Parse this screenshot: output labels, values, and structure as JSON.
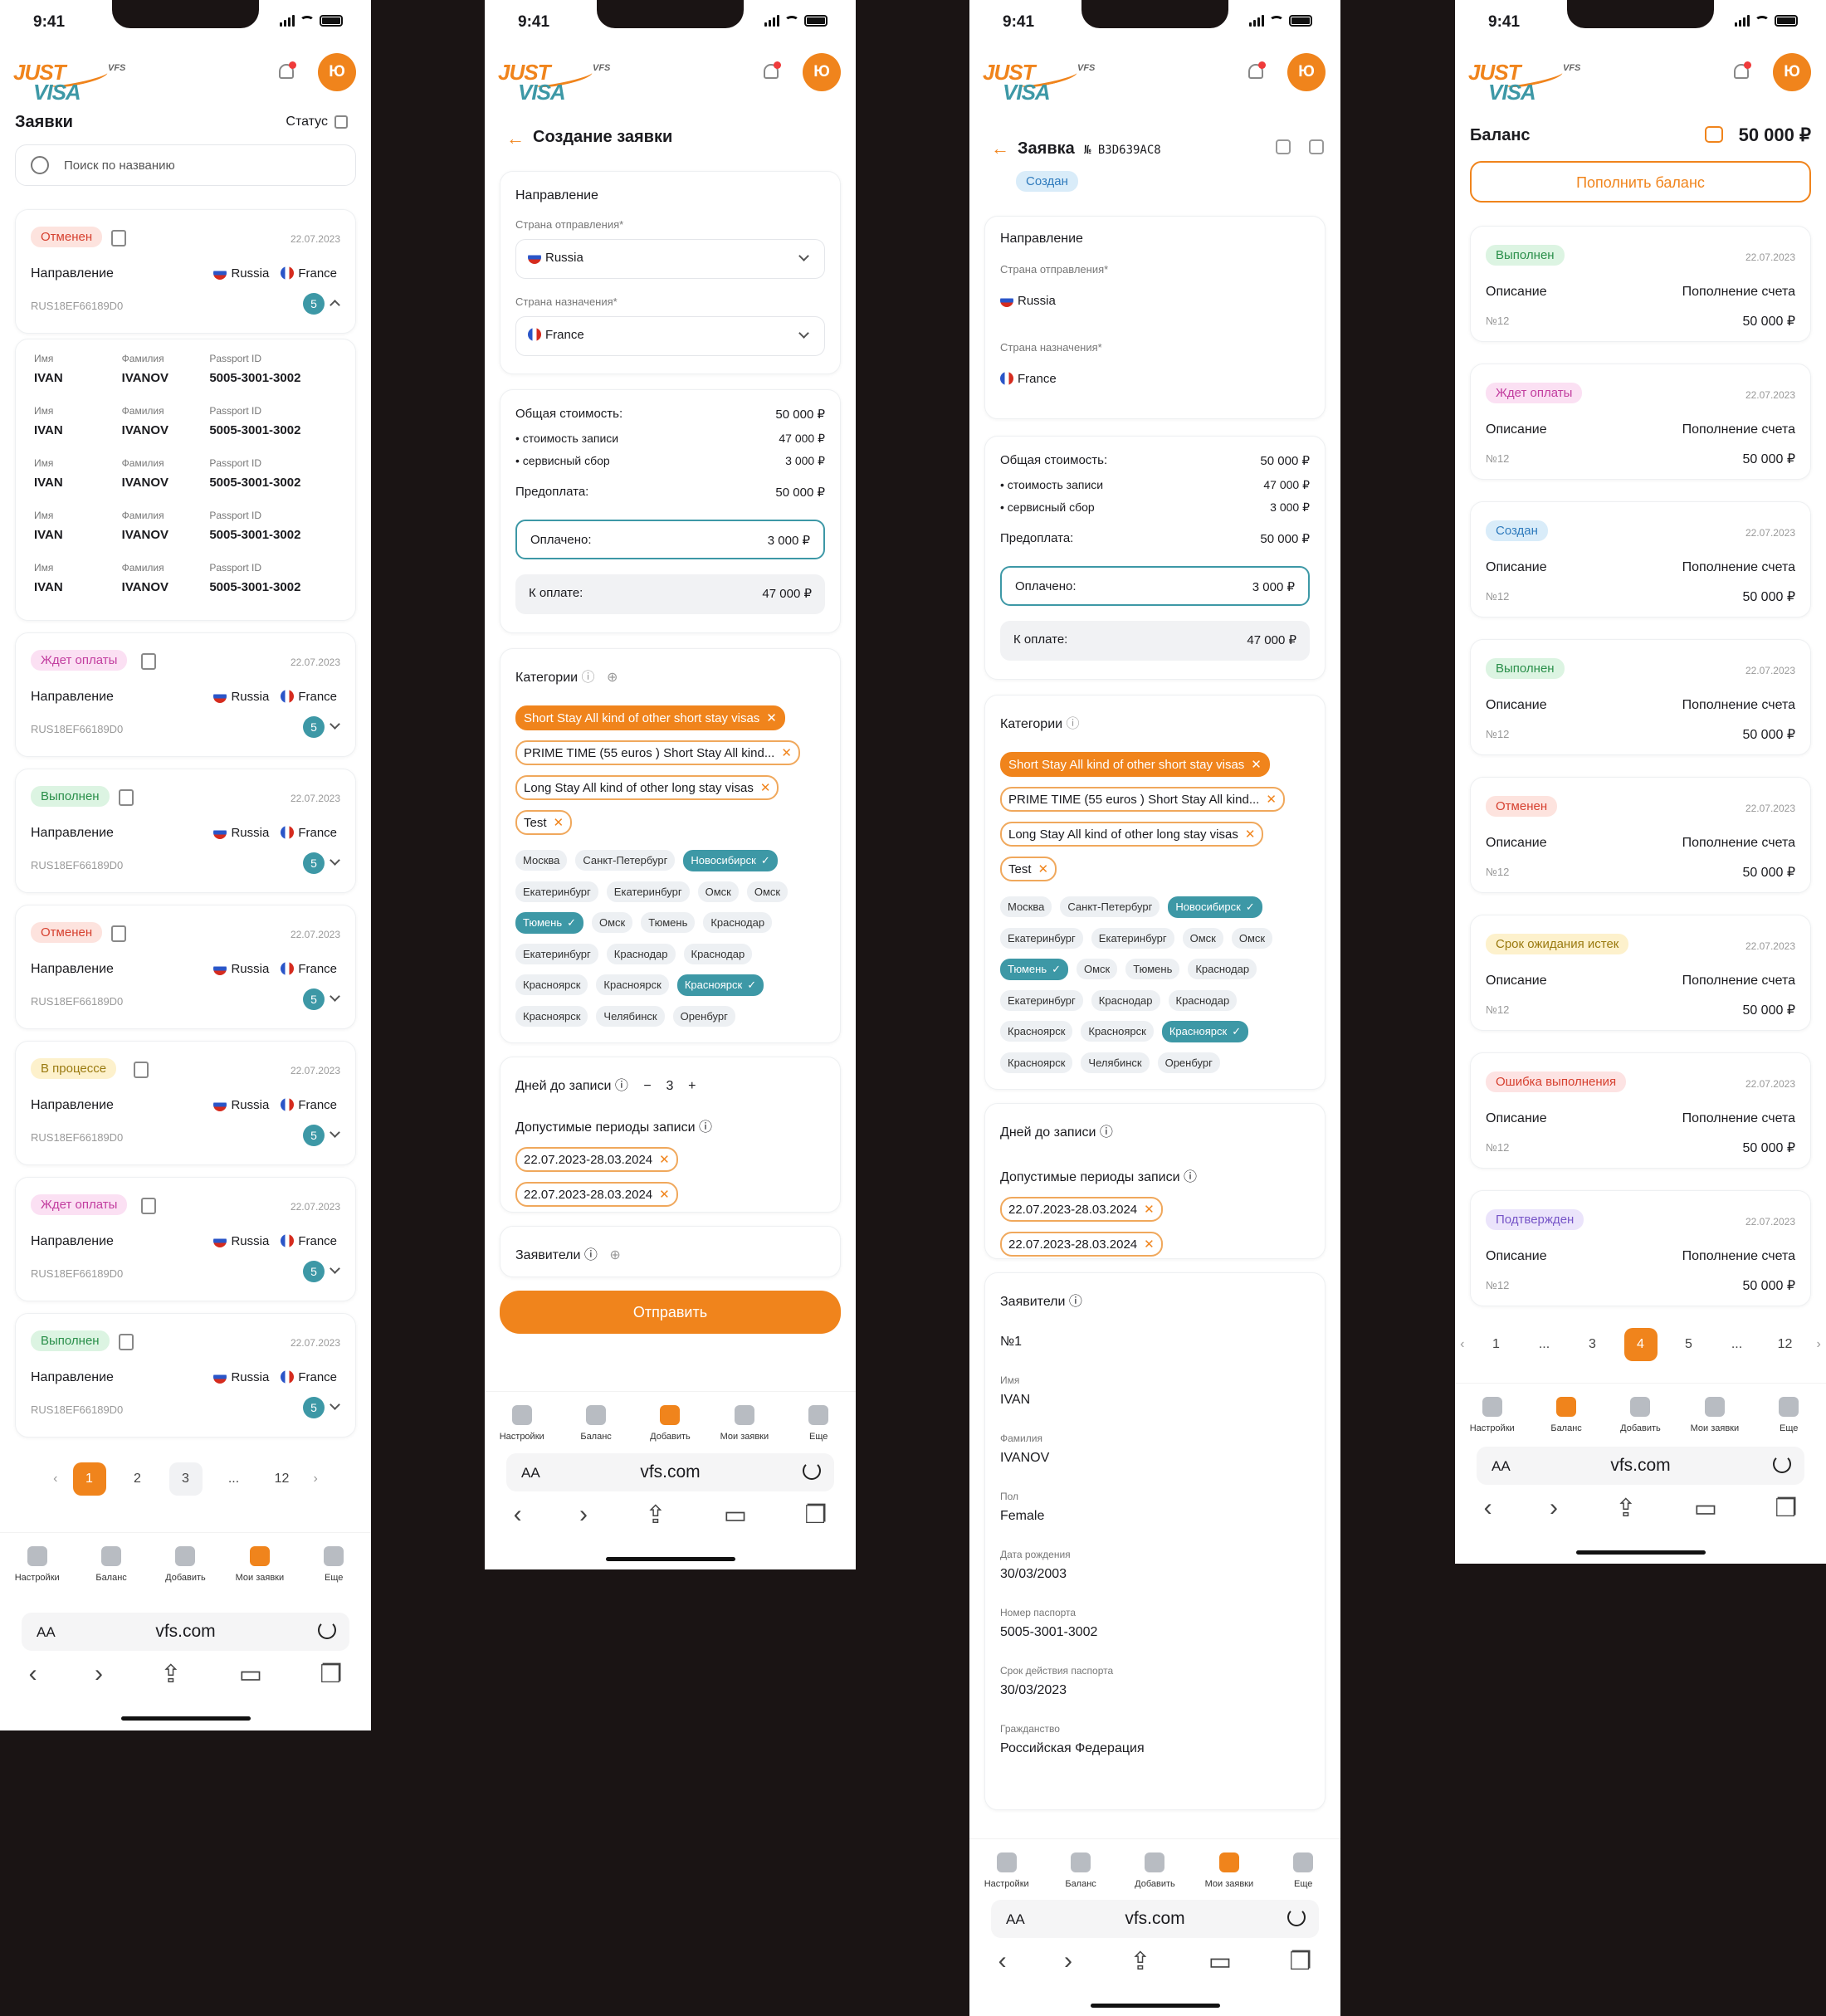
{
  "status_time": "9:41",
  "logo": {
    "just": "JUST",
    "visa": "VISA",
    "vfs": "VFS"
  },
  "avatar": "Ю",
  "screen1": {
    "title": "Заявки",
    "status_label": "Статус",
    "search_placeholder": "Поиск по названию",
    "direction_label": "Направление",
    "from": "Russia",
    "to": "France",
    "code": "RUS18EF66189D0",
    "count": "5",
    "cards": [
      {
        "badge": "Отменен",
        "date": "22.07.2023"
      },
      {
        "badge": "Ждет оплаты",
        "date": "22.07.2023"
      },
      {
        "badge": "Выполнен",
        "date": "22.07.2023"
      },
      {
        "badge": "Отменен",
        "date": "22.07.2023"
      },
      {
        "badge": "В процессе",
        "date": "22.07.2023"
      },
      {
        "badge": "Ждет оплаты",
        "date": "22.07.2023"
      },
      {
        "badge": "Выполнен",
        "date": "22.07.2023"
      }
    ],
    "applicants_headers": {
      "name": "Имя",
      "surname": "Фамилия",
      "passport": "Passport ID"
    },
    "applicants": [
      {
        "name": "IVAN",
        "surname": "IVANOV",
        "passport": "5005-3001-3002"
      },
      {
        "name": "IVAN",
        "surname": "IVANOV",
        "passport": "5005-3001-3002"
      },
      {
        "name": "IVAN",
        "surname": "IVANOV",
        "passport": "5005-3001-3002"
      },
      {
        "name": "IVAN",
        "surname": "IVANOV",
        "passport": "5005-3001-3002"
      },
      {
        "name": "IVAN",
        "surname": "IVANOV",
        "passport": "5005-3001-3002"
      }
    ],
    "pager": [
      "1",
      "2",
      "3",
      "...",
      "12"
    ]
  },
  "screen2": {
    "title": "Создание заявки",
    "direction": "Направление",
    "from_label": "Страна отправления*",
    "from": "Russia",
    "to_label": "Страна назначения*",
    "to": "France",
    "total_label": "Общая стоимость:",
    "total": "50 000 ₽",
    "rec_label": "стоимость записи",
    "rec": "47 000 ₽",
    "fee_label": "сервисный сбор",
    "fee": "3 000 ₽",
    "prepay_label": "Предоплата:",
    "prepay": "50 000 ₽",
    "paid_label": "Оплачено:",
    "paid": "3 000 ₽",
    "topay_label": "К оплате:",
    "topay": "47 000 ₽",
    "categories": "Категории",
    "tags": [
      "Short Stay All kind of other short stay visas",
      "PRIME TIME (55 euros ) Short Stay All kind...",
      "Long Stay All kind of other long stay visas",
      "Test"
    ],
    "cities": [
      "Москва",
      "Санкт-Петербург",
      "Новосибирск",
      "Екатеринбург",
      "Екатеринбург",
      "Омск",
      "Омск",
      "Тюмень",
      "Омск",
      "Тюмень",
      "Краснодар",
      "Екатеринбург",
      "Краснодар",
      "Краснодар",
      "Красноярск",
      "Красноярск",
      "Красноярск",
      "Красноярск",
      "Челябинск",
      "Оренбург"
    ],
    "days_label": "Дней до записи",
    "days": "3",
    "periods_label": "Допустимые периоды записи",
    "periods": [
      "22.07.2023-28.03.2024",
      "22.07.2023-28.03.2024"
    ],
    "applicants": "Заявители",
    "submit": "Отправить"
  },
  "screen3": {
    "title": "Заявка",
    "number": "№ B3D639AC8",
    "badge": "Создан",
    "applicant_no": "№1",
    "fields": [
      {
        "label": "Имя",
        "value": "IVAN"
      },
      {
        "label": "Фамилия",
        "value": "IVANOV"
      },
      {
        "label": "Пол",
        "value": "Female"
      },
      {
        "label": "Дата рождения",
        "value": "30/03/2003"
      },
      {
        "label": "Номер паспорта",
        "value": "5005-3001-3002"
      },
      {
        "label": "Срок действия паспорта",
        "value": "30/03/2023"
      },
      {
        "label": "Гражданство",
        "value": "Российская Федерация"
      }
    ]
  },
  "screen4": {
    "title": "Баланс",
    "balance": "50 000 ₽",
    "topup": "Пополнить баланс",
    "desc_label": "Описание",
    "desc": "Пополнение счета",
    "no": "№12",
    "amount": "50 000 ₽",
    "items": [
      {
        "badge": "Выполнен",
        "date": "22.07.2023"
      },
      {
        "badge": "Ждет оплаты",
        "date": "22.07.2023"
      },
      {
        "badge": "Создан",
        "date": "22.07.2023"
      },
      {
        "badge": "Выполнен",
        "date": "22.07.2023"
      },
      {
        "badge": "Отменен",
        "date": "22.07.2023"
      },
      {
        "badge": "Срок ожидания истек",
        "date": "22.07.2023"
      },
      {
        "badge": "Ошибка выполнения",
        "date": "22.07.2023"
      },
      {
        "badge": "Подтвержден",
        "date": "22.07.2023"
      }
    ],
    "pager": [
      "1",
      "...",
      "3",
      "4",
      "5",
      "...",
      "12"
    ]
  },
  "tabbar": {
    "settings": "Настройки",
    "balance": "Баланс",
    "add": "Добавить",
    "my": "Мои заявки",
    "more": "Еще"
  },
  "browser": {
    "aa": "AA",
    "url": "vfs.com"
  },
  "colors": {
    "accent": "#f0841c",
    "teal": "#3d98a6"
  }
}
